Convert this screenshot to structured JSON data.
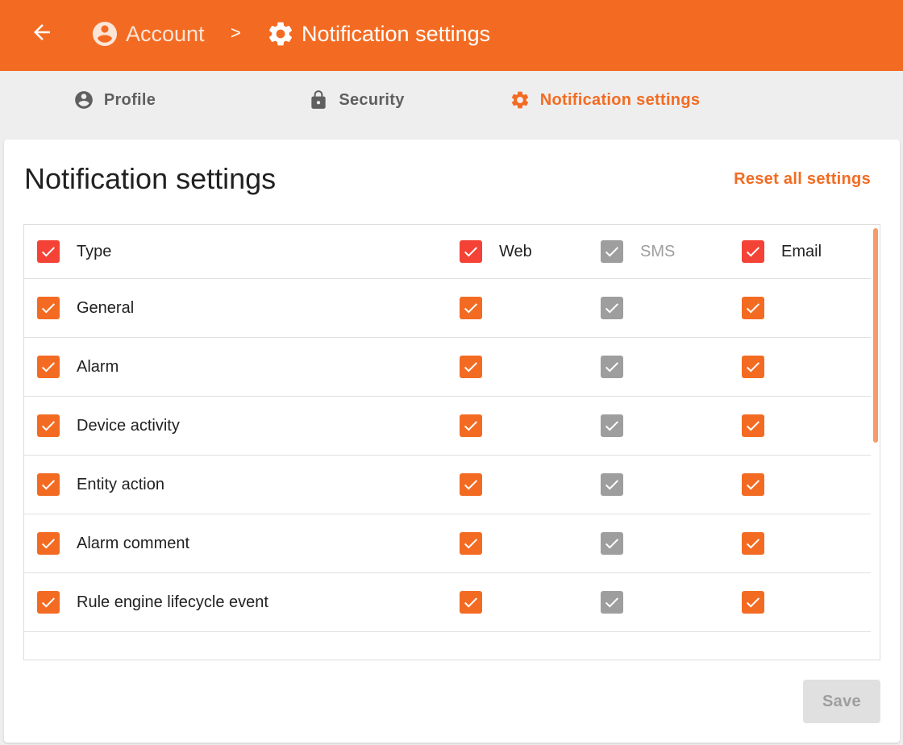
{
  "header": {
    "breadcrumb": [
      {
        "label": "Account",
        "icon": "account-circle-icon"
      },
      {
        "label": "Notification settings",
        "icon": "gear-icon"
      }
    ],
    "separator": ">",
    "background_color": "#f36b22"
  },
  "tabs": [
    {
      "label": "Profile",
      "icon": "account-circle-icon",
      "active": false
    },
    {
      "label": "Security",
      "icon": "lock-icon",
      "active": false
    },
    {
      "label": "Notification settings",
      "icon": "gear-icon",
      "active": true
    }
  ],
  "card": {
    "title": "Notification settings",
    "reset_label": "Reset all settings"
  },
  "table": {
    "columns": {
      "type": "Type",
      "web": "Web",
      "sms": "SMS",
      "email": "Email"
    },
    "header_checked": {
      "type": true,
      "web": true,
      "sms": true,
      "email": true
    },
    "sms_disabled": true,
    "rows": [
      {
        "label": "General",
        "type": true,
        "web": true,
        "sms": true,
        "email": true
      },
      {
        "label": "Alarm",
        "type": true,
        "web": true,
        "sms": true,
        "email": true
      },
      {
        "label": "Device activity",
        "type": true,
        "web": true,
        "sms": true,
        "email": true
      },
      {
        "label": "Entity action",
        "type": true,
        "web": true,
        "sms": true,
        "email": true
      },
      {
        "label": "Alarm comment",
        "type": true,
        "web": true,
        "sms": true,
        "email": true
      },
      {
        "label": "Rule engine lifecycle event",
        "type": true,
        "web": true,
        "sms": true,
        "email": true
      }
    ]
  },
  "footer": {
    "save_label": "Save",
    "save_disabled": true
  },
  "colors": {
    "accent": "#f36b22",
    "header_checkbox": "#f44336",
    "disabled_checkbox": "#9e9e9e"
  }
}
